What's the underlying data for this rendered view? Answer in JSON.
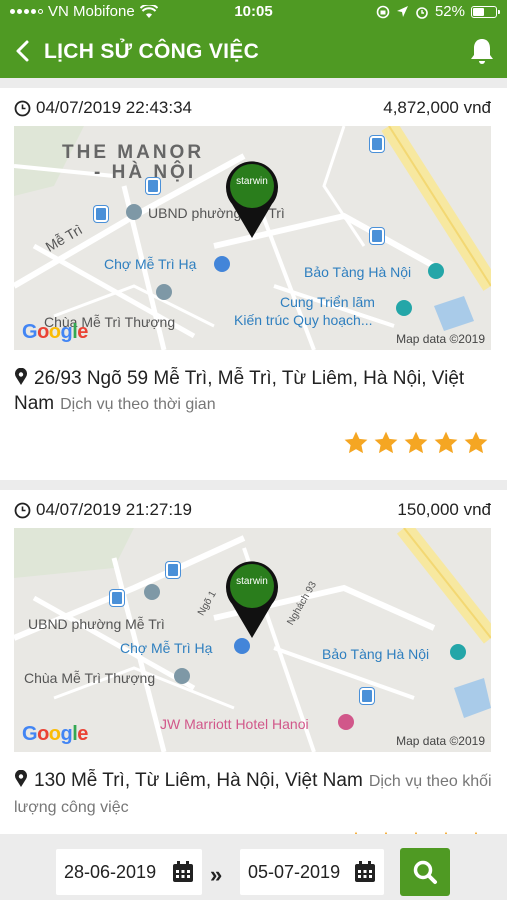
{
  "status_bar": {
    "carrier": "VN Mobifone",
    "time": "10:05",
    "battery": "52%",
    "battery_level": 0.52
  },
  "header": {
    "title": "LỊCH SỬ CÔNG VIỆC"
  },
  "jobs": [
    {
      "datetime": "04/07/2019 22:43:34",
      "price": "4,872,000 vnđ",
      "address": "26/93 Ngõ 59 Mễ Trì, Mễ Trì, Từ Liêm, Hà Nội, Việt Nam",
      "service": "Dịch vụ theo thời gian",
      "rating": 5,
      "map": {
        "pin_label": "starwin",
        "labels": [
          "THE MANOR",
          "- HÀ NỘI",
          "UBND phường Mễ Trì",
          "Mễ Trì",
          "Chợ Mễ Trì Hạ",
          "Bảo Tàng Hà Nội",
          "Cung Triển lãm",
          "Kiến trúc Quy hoạch...",
          "Chùa Mễ Trì Thượng"
        ],
        "google": "Google",
        "attribution": "Map data ©2019"
      }
    },
    {
      "datetime": "04/07/2019 21:27:19",
      "price": "150,000 vnđ",
      "address": "130 Mễ Trì, Từ Liêm, Hà Nội, Việt Nam",
      "service": "Dịch vụ theo khối lượng công việc",
      "rating": 5,
      "map": {
        "pin_label": "starwin",
        "labels": [
          "UBND phường Mễ Trì",
          "Chợ Mễ Trì Hạ",
          "Bảo Tàng Hà Nội",
          "Chùa Mễ Trì Thượng",
          "JW Marriott Hotel Hanoi",
          "Ngõ 1",
          "Nghách 93"
        ],
        "google": "Google",
        "attribution": "Map data ©2019"
      }
    }
  ],
  "filter": {
    "from_date": "28-06-2019",
    "to_date": "05-07-2019",
    "separator": "»"
  },
  "colors": {
    "brand": "#4f9a23",
    "star": "#f5a623",
    "pin": "#2a7d1c"
  },
  "icons": [
    "back-arrow-icon",
    "bell-icon",
    "clock-icon",
    "location-pin-icon",
    "star-icon",
    "calendar-icon",
    "search-icon",
    "wifi-icon",
    "battery-icon"
  ]
}
